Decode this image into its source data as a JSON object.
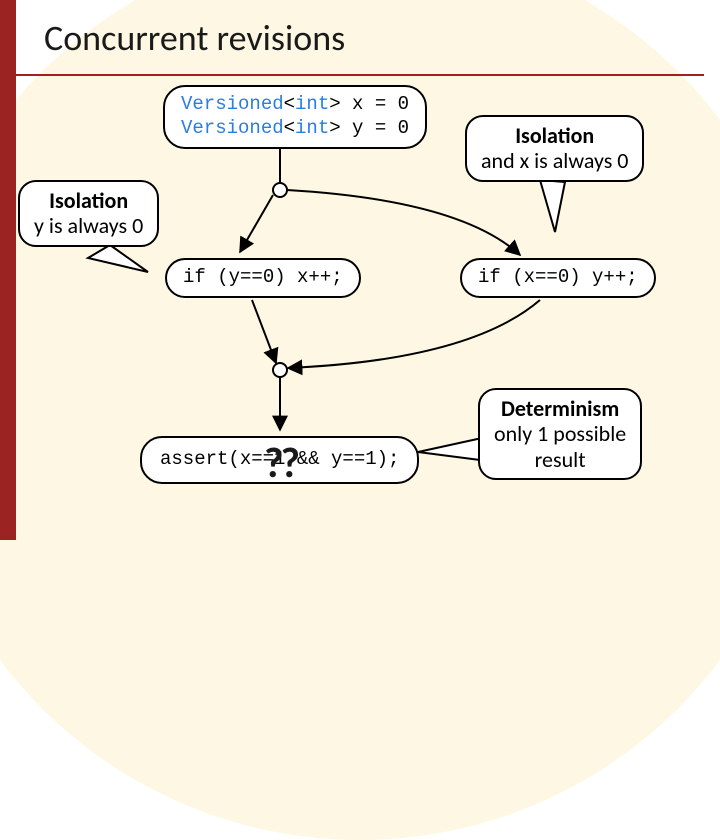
{
  "title": "Concurrent revisions",
  "code_top_line1_a": "Versioned",
  "code_top_line1_b": "<",
  "code_top_line1_c": "int",
  "code_top_line1_d": "> x = 0",
  "code_top_line2_a": "Versioned",
  "code_top_line2_b": "<",
  "code_top_line2_c": "int",
  "code_top_line2_d": "> y = 0",
  "code_left": "if (y==0) x++;",
  "code_right": "if (x==0) y++;",
  "code_bottom": "assert(x==1 && y==1);",
  "callout_left_bold": "Isolation",
  "callout_left_rest": "y is always 0",
  "callout_right_bold": "Isolation",
  "callout_right_rest": "and x is always 0",
  "callout_det_bold": "Determinism",
  "callout_det_rest1": "only 1 possible",
  "callout_det_rest2": "result",
  "qmark": "??",
  "embedded": "??"
}
